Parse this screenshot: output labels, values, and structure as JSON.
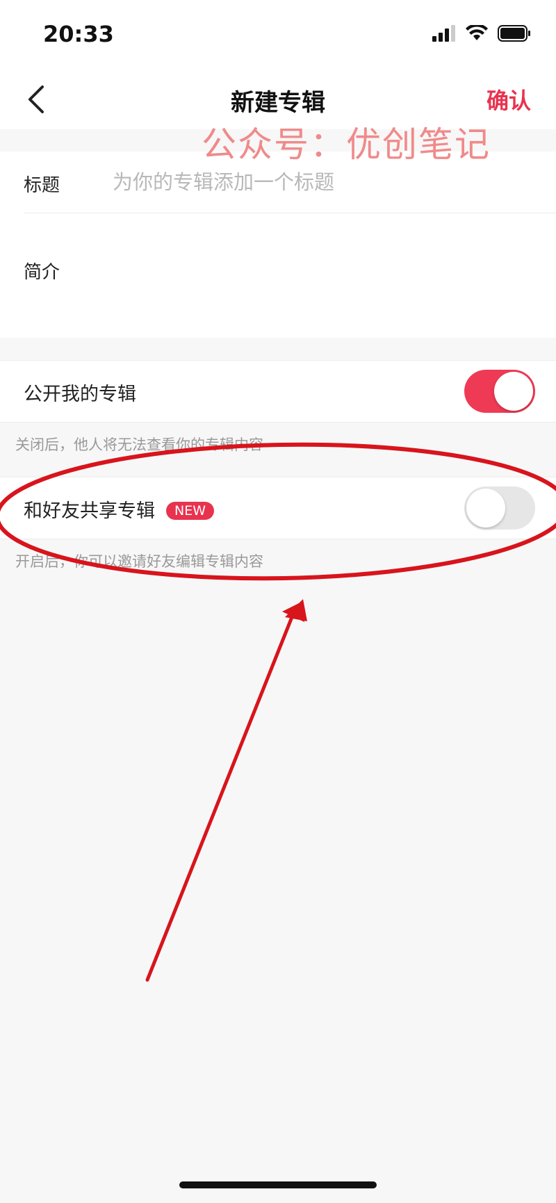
{
  "status_bar": {
    "time": "20:33",
    "icons": [
      "signal-icon",
      "wifi-icon",
      "battery-icon"
    ]
  },
  "nav": {
    "title": "新建专辑",
    "confirm_label": "确认",
    "back_icon": "chevron-left-icon"
  },
  "watermark": "公众号：优创笔记",
  "form": {
    "title_label": "标题",
    "title_placeholder": "为你的专辑添加一个标题",
    "title_value": "",
    "intro_label": "简介",
    "intro_value": ""
  },
  "public_toggle": {
    "label": "公开我的专辑",
    "on": true,
    "hint": "关闭后，他人将无法查看你的专辑内容"
  },
  "share_toggle": {
    "label": "和好友共享专辑",
    "badge": "NEW",
    "on": false,
    "hint": "开启后，你可以邀请好友编辑专辑内容"
  },
  "colors": {
    "accent": "#e8334f",
    "toggle_on": "#ef3a55",
    "toggle_off": "#e6e6e6",
    "annotation": "#d8141c",
    "watermark": "#f08a8a"
  }
}
